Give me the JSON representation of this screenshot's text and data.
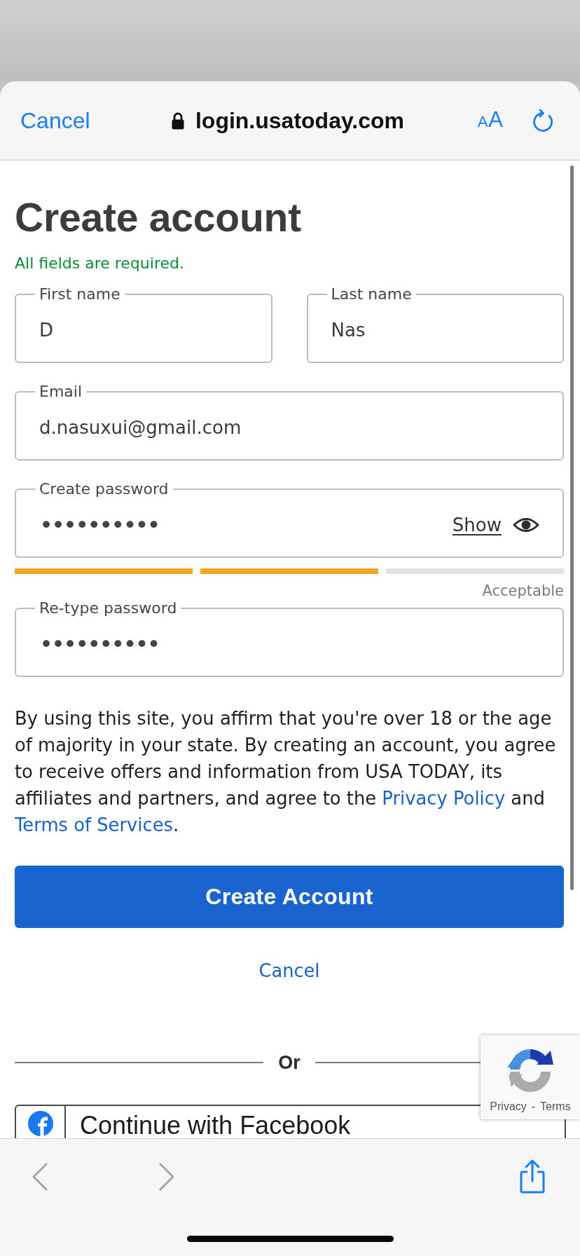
{
  "browser": {
    "cancel": "Cancel",
    "secure": true,
    "url": "login.usatoday.com",
    "text_size": {
      "small": "A",
      "large": "A"
    }
  },
  "form": {
    "title": "Create account",
    "note": "All fields are required.",
    "rows": [
      [
        {
          "kind": "text",
          "label": "First name",
          "value": "D"
        },
        {
          "kind": "text",
          "label": "Last name",
          "value": "Nas"
        }
      ],
      [
        {
          "kind": "text",
          "label": "Email",
          "value": "d.nasuxui@gmail.com"
        }
      ],
      [
        {
          "kind": "password",
          "label": "Create password",
          "value": "••••••••••",
          "toggle": "Show",
          "strength": {
            "segments": [
              {
                "filled": true
              },
              {
                "filled": true
              },
              {
                "filled": false
              }
            ],
            "label": "Acceptable"
          }
        }
      ],
      [
        {
          "kind": "password",
          "label": "Re-type password",
          "value": "••••••••••"
        }
      ]
    ],
    "terms": [
      {
        "kind": "text",
        "text": "By using this site, you affirm that you're over 18 or the age of majority in your state. By creating an account, you agree to receive offers and information from USA TODAY, its affiliates and partners, and agree to the "
      },
      {
        "kind": "link",
        "text": "Privacy Policy"
      },
      {
        "kind": "text",
        "text": " and "
      },
      {
        "kind": "link",
        "text": "Terms of Services"
      },
      {
        "kind": "text",
        "text": "."
      }
    ],
    "submit": "Create Account",
    "cancel": "Cancel",
    "divider": "Or",
    "social": [
      {
        "kind": "facebook",
        "label": "Continue with Facebook"
      }
    ]
  },
  "badge": {
    "links": [
      "Privacy",
      "Terms"
    ],
    "separator": "-"
  },
  "toolbar": {
    "back": {
      "disabled": true
    },
    "forward": {
      "disabled": true
    }
  }
}
